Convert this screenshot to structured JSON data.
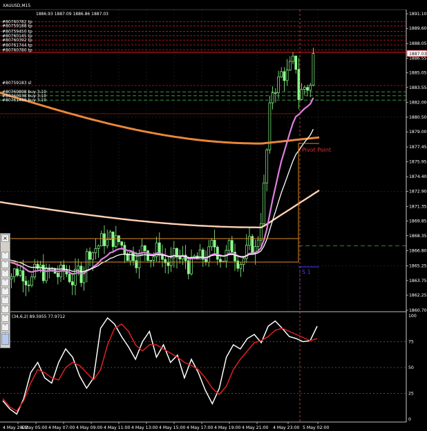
{
  "header": {
    "symbol": "XAUUSD,M15",
    "quotes": "1886.93 1887.09 1886.86 1887.03"
  },
  "order_labels_top": [
    "#80760782 tp",
    "#80759188 tp",
    "#80759450 tp",
    "#80760145 tp",
    "#80760392 tp",
    "#80761744 tp",
    "#80760780 tp"
  ],
  "order_labels_mid": [
    "#80759183 sl",
    "#80760808 buy 3.10",
    "#80760938 buy 3.10",
    "#80761488 buy 3.10"
  ],
  "price_axis": {
    "ticks": [
      "1891.10",
      "1889.60",
      "1888.05",
      "1886.55",
      "1885.05",
      "1883.55",
      "1882.00",
      "1880.50",
      "1879.00",
      "1877.45",
      "1875.95",
      "1874.40",
      "1872.90",
      "1871.35",
      "1869.85",
      "1868.35",
      "1866.80",
      "1865.25",
      "1863.75",
      "1862.25",
      "1860.70"
    ],
    "current": "1887.03"
  },
  "indicator": {
    "label": "(34,6,2) 89.5955 77.9712",
    "ticks": [
      "100",
      "75",
      "50",
      "25",
      "0"
    ]
  },
  "time_axis": [
    "4 May 2022",
    "4 May 05:00",
    "4 May 07:00",
    "4 May 09:00",
    "4 May 11:00",
    "4 May 13:00",
    "4 May 15:00",
    "4 May 17:00",
    "4 May 19:00",
    "4 May 21:00",
    "4 May 23:00",
    "5 May 02:00"
  ],
  "annotations": {
    "pivot": "Pivot Point",
    "support": "S 1"
  },
  "colors": {
    "background": "#000000",
    "grid": "#646464",
    "candle": "#8cff8c",
    "ma_orange": "#e8883a",
    "ma_peach": "#ffd2b4",
    "ma_pink": "#e080e0",
    "ma_white": "#ffffff",
    "stoch_main": "#ffffff",
    "stoch_signal": "#e02020",
    "tp_line": "#c8141e",
    "buy_line": "#3cb44b",
    "pivot": "#dc8c28",
    "support": "#3c3cff"
  },
  "panel_icons": [
    "close-icon",
    "arrow-up-icon",
    "arrow-up-icon",
    "arrow-up-icon",
    "arrow-up-icon",
    "arrow-up-icon",
    "arrow-up-icon",
    "arrow-up-icon",
    "arrow-up-icon",
    "arrow-up-icon",
    "arrow-up-icon"
  ]
}
